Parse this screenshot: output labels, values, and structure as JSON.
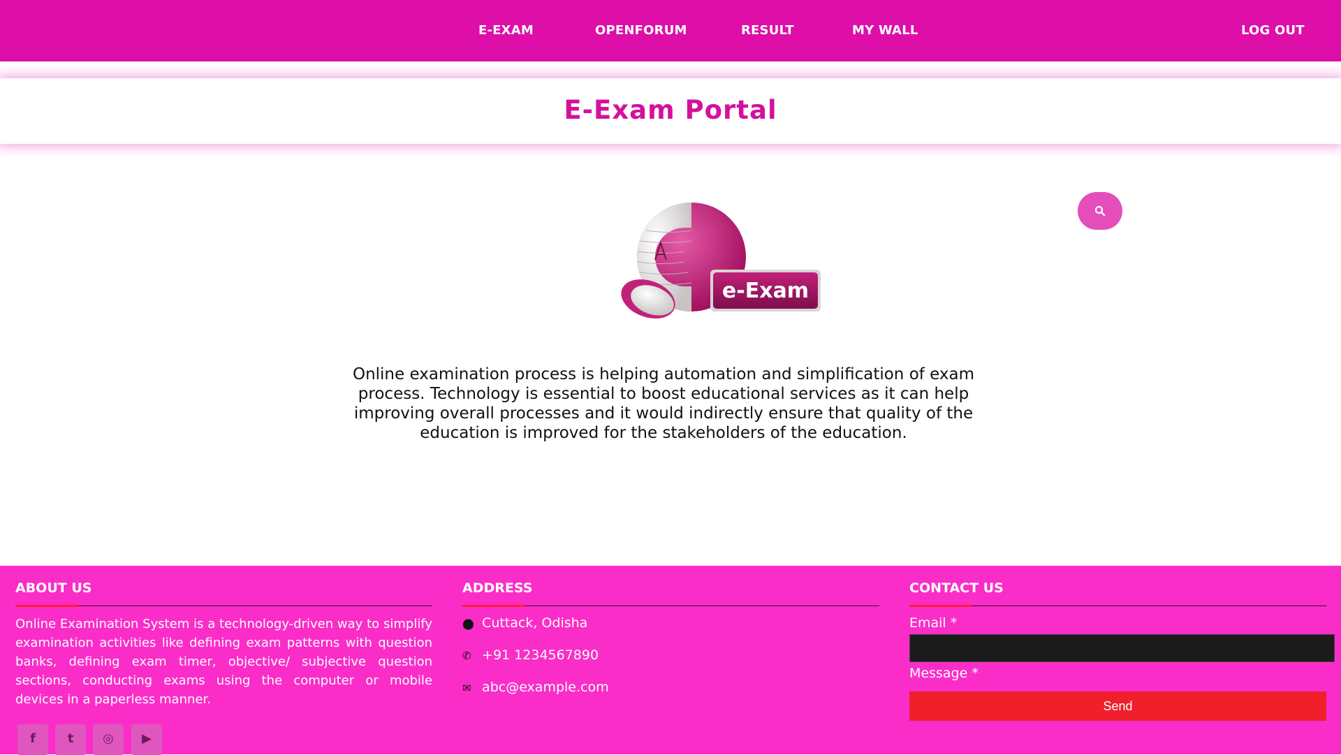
{
  "nav": {
    "items": [
      {
        "label": "E-EXAM"
      },
      {
        "label": "OPENFORUM"
      },
      {
        "label": "RESULT"
      },
      {
        "label": "MY WALL"
      }
    ],
    "logout": "LOG OUT"
  },
  "title": "E-Exam Portal",
  "logo": {
    "badge_text": "e-Exam",
    "grade_text": "A+"
  },
  "intro": "Online examination process is helping automation and simplification of exam process. Technology is essential to boost educational services as it can help improving overall processes and it would indirectly ensure that quality of the education is improved for the stakeholders of the education.",
  "footer": {
    "about": {
      "heading": "ABOUT US",
      "text": "Online Examination System is a technology-driven way to simplify examination activities like defining exam patterns with question banks, defining exam timer, objective/ subjective question sections, conducting exams using the computer or mobile devices in a paperless manner.",
      "social": [
        {
          "icon": "facebook-icon",
          "glyph": "f"
        },
        {
          "icon": "twitter-icon",
          "glyph": "t"
        },
        {
          "icon": "instagram-icon",
          "glyph": "◎"
        },
        {
          "icon": "youtube-icon",
          "glyph": "▶"
        }
      ]
    },
    "address": {
      "heading": "ADDRESS",
      "location": "Cuttack, Odisha",
      "phone": "+91 1234567890",
      "email": "abc@example.com"
    },
    "contact": {
      "heading": "CONTACT US",
      "email_label": "Email *",
      "message_label": "Message *",
      "send_label": "Send"
    }
  },
  "colors": {
    "nav": "#de0fa8",
    "title": "#d3119e",
    "footer": "#fa2dc8",
    "send": "#f01f2c",
    "search": "#e44dba"
  }
}
